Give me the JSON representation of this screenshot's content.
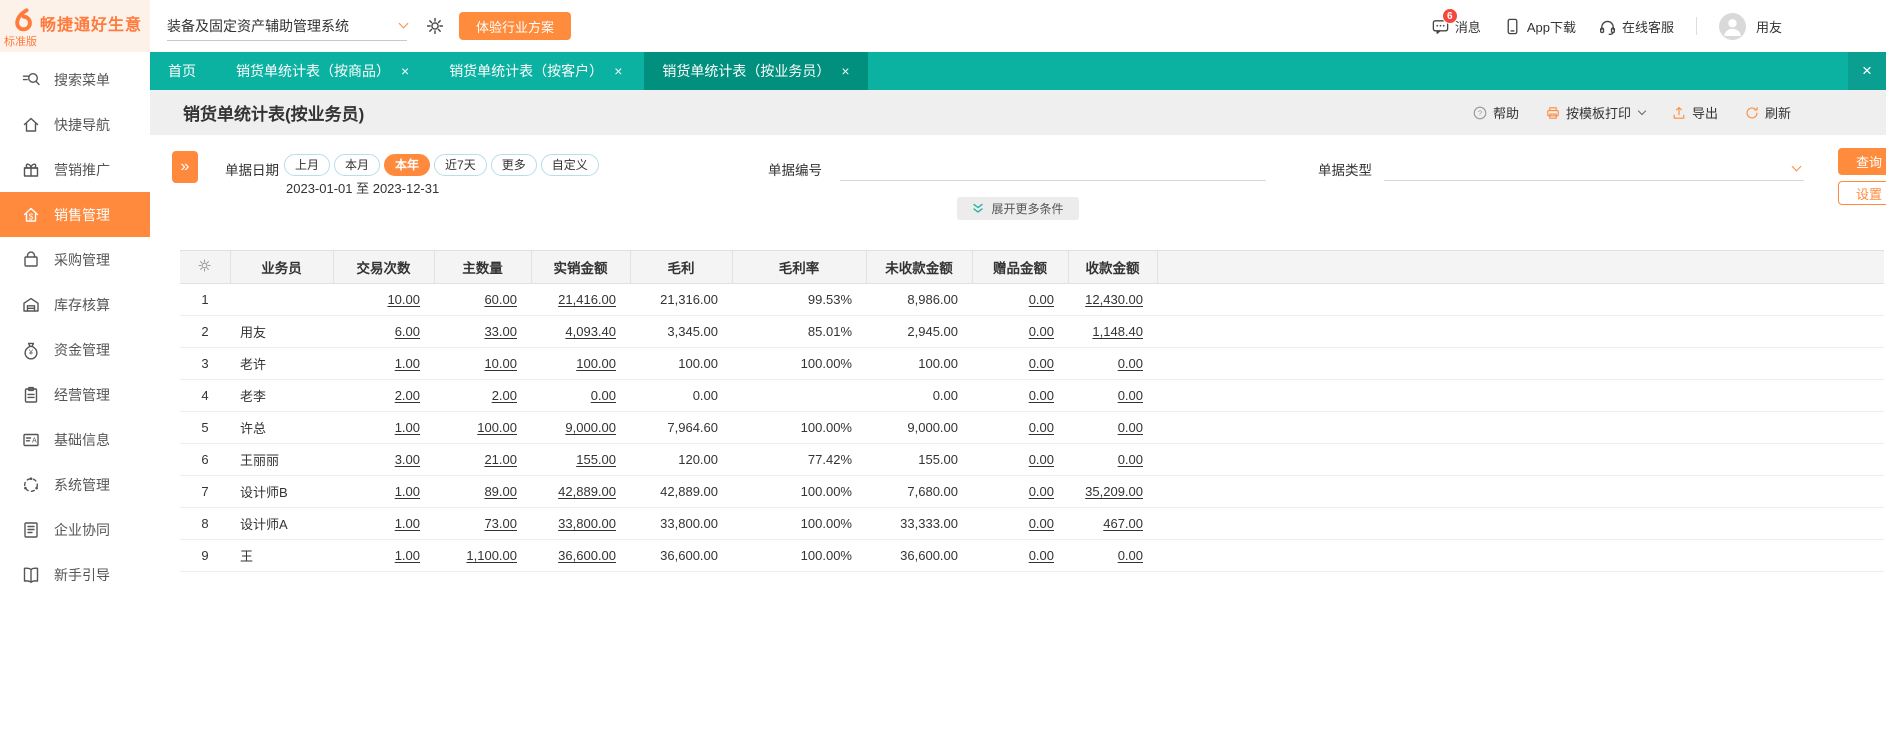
{
  "colors": {
    "teal": "#0cb2a1",
    "teal_active_tab": "#00907d",
    "orange": "#ff8a3e",
    "badge_red": "#f5483d",
    "titlebar_bg": "#efefef"
  },
  "brand": {
    "name": "畅捷通好生意",
    "edition": "标准版"
  },
  "topbar": {
    "system_select": "装备及固定资产辅助管理系统",
    "trial_button": "体验行业方案",
    "messages_label": "消息",
    "messages_badge": "6",
    "app_download_label": "App下载",
    "online_service_label": "在线客服",
    "username": "用友"
  },
  "tabs": [
    {
      "key": "home",
      "label": "首页",
      "closable": false,
      "active": false
    },
    {
      "key": "by-product",
      "label": "销货单统计表（按商品）",
      "closable": true,
      "active": false
    },
    {
      "key": "by-customer",
      "label": "销货单统计表（按客户）",
      "closable": true,
      "active": false
    },
    {
      "key": "by-salesperson",
      "label": "销货单统计表（按业务员）",
      "closable": true,
      "active": true
    }
  ],
  "page": {
    "title": "销货单统计表(按业务员)",
    "toolbar": {
      "help": "帮助",
      "print": "按模板打印",
      "export": "导出",
      "refresh": "刷新"
    }
  },
  "filters": {
    "date_label": "单据日期",
    "date_presets": [
      "上月",
      "本月",
      "本年",
      "近7天",
      "更多",
      "自定义"
    ],
    "date_selected": "本年",
    "date_range": "2023-01-01 至 2023-12-31",
    "doc_no_label": "单据编号",
    "doc_no_value": "",
    "doc_type_label": "单据类型",
    "doc_type_value": "",
    "search_button": "查询",
    "settings_button": "设置",
    "expand_more": "展开更多条件"
  },
  "sidebar": {
    "items": [
      {
        "key": "search-menu",
        "icon": "search",
        "label": "搜索菜单",
        "active": false
      },
      {
        "key": "quick-nav",
        "icon": "home",
        "label": "快捷导航",
        "active": false
      },
      {
        "key": "marketing",
        "icon": "gift",
        "label": "营销推广",
        "active": false
      },
      {
        "key": "sales-mgmt",
        "icon": "sales",
        "label": "销售管理",
        "active": true
      },
      {
        "key": "purchase-mgmt",
        "icon": "purchase",
        "label": "采购管理",
        "active": false
      },
      {
        "key": "inventory-accounting",
        "icon": "inventory",
        "label": "库存核算",
        "active": false
      },
      {
        "key": "funds-mgmt",
        "icon": "funds",
        "label": "资金管理",
        "active": false
      },
      {
        "key": "operations-mgmt",
        "icon": "operations",
        "label": "经营管理",
        "active": false
      },
      {
        "key": "base-info",
        "icon": "baseinfo",
        "label": "基础信息",
        "active": false
      },
      {
        "key": "system-mgmt",
        "icon": "system",
        "label": "系统管理",
        "active": false
      },
      {
        "key": "enterprise-collab",
        "icon": "collab",
        "label": "企业协同",
        "active": false
      },
      {
        "key": "beginner-guide",
        "icon": "guide",
        "label": "新手引导",
        "active": false
      }
    ]
  },
  "table": {
    "columns": [
      "业务员",
      "交易次数",
      "主数量",
      "实销金额",
      "毛利",
      "毛利率",
      "未收款金额",
      "赠品金额",
      "收款金额"
    ],
    "column_keys": [
      "salesperson",
      "trade-count",
      "main-qty",
      "net-sales-amount",
      "gross-profit",
      "gross-margin",
      "unreceived-amount",
      "gift-amount",
      "received-amount"
    ],
    "link_columns": [
      "交易次数",
      "主数量",
      "实销金额",
      "赠品金额",
      "收款金额"
    ],
    "rows": [
      {
        "no": "1",
        "salesperson": "",
        "values": [
          "10.00",
          "60.00",
          "21,416.00",
          "21,316.00",
          "99.53%",
          "8,986.00",
          "0.00",
          "12,430.00"
        ]
      },
      {
        "no": "2",
        "salesperson": "用友",
        "values": [
          "6.00",
          "33.00",
          "4,093.40",
          "3,345.00",
          "85.01%",
          "2,945.00",
          "0.00",
          "1,148.40"
        ]
      },
      {
        "no": "3",
        "salesperson": "老许",
        "values": [
          "1.00",
          "10.00",
          "100.00",
          "100.00",
          "100.00%",
          "100.00",
          "0.00",
          "0.00"
        ]
      },
      {
        "no": "4",
        "salesperson": "老李",
        "values": [
          "2.00",
          "2.00",
          "0.00",
          "0.00",
          "",
          "0.00",
          "0.00",
          "0.00"
        ]
      },
      {
        "no": "5",
        "salesperson": "许总",
        "values": [
          "1.00",
          "100.00",
          "9,000.00",
          "7,964.60",
          "100.00%",
          "9,000.00",
          "0.00",
          "0.00"
        ]
      },
      {
        "no": "6",
        "salesperson": "王丽丽",
        "values": [
          "3.00",
          "21.00",
          "155.00",
          "120.00",
          "77.42%",
          "155.00",
          "0.00",
          "0.00"
        ]
      },
      {
        "no": "7",
        "salesperson": "设计师B",
        "values": [
          "1.00",
          "89.00",
          "42,889.00",
          "42,889.00",
          "100.00%",
          "7,680.00",
          "0.00",
          "35,209.00"
        ]
      },
      {
        "no": "8",
        "salesperson": "设计师A",
        "values": [
          "1.00",
          "73.00",
          "33,800.00",
          "33,800.00",
          "100.00%",
          "33,333.00",
          "0.00",
          "467.00"
        ]
      },
      {
        "no": "9",
        "salesperson": "王",
        "values": [
          "1.00",
          "1,100.00",
          "36,600.00",
          "36,600.00",
          "100.00%",
          "36,600.00",
          "0.00",
          "0.00"
        ]
      }
    ]
  }
}
